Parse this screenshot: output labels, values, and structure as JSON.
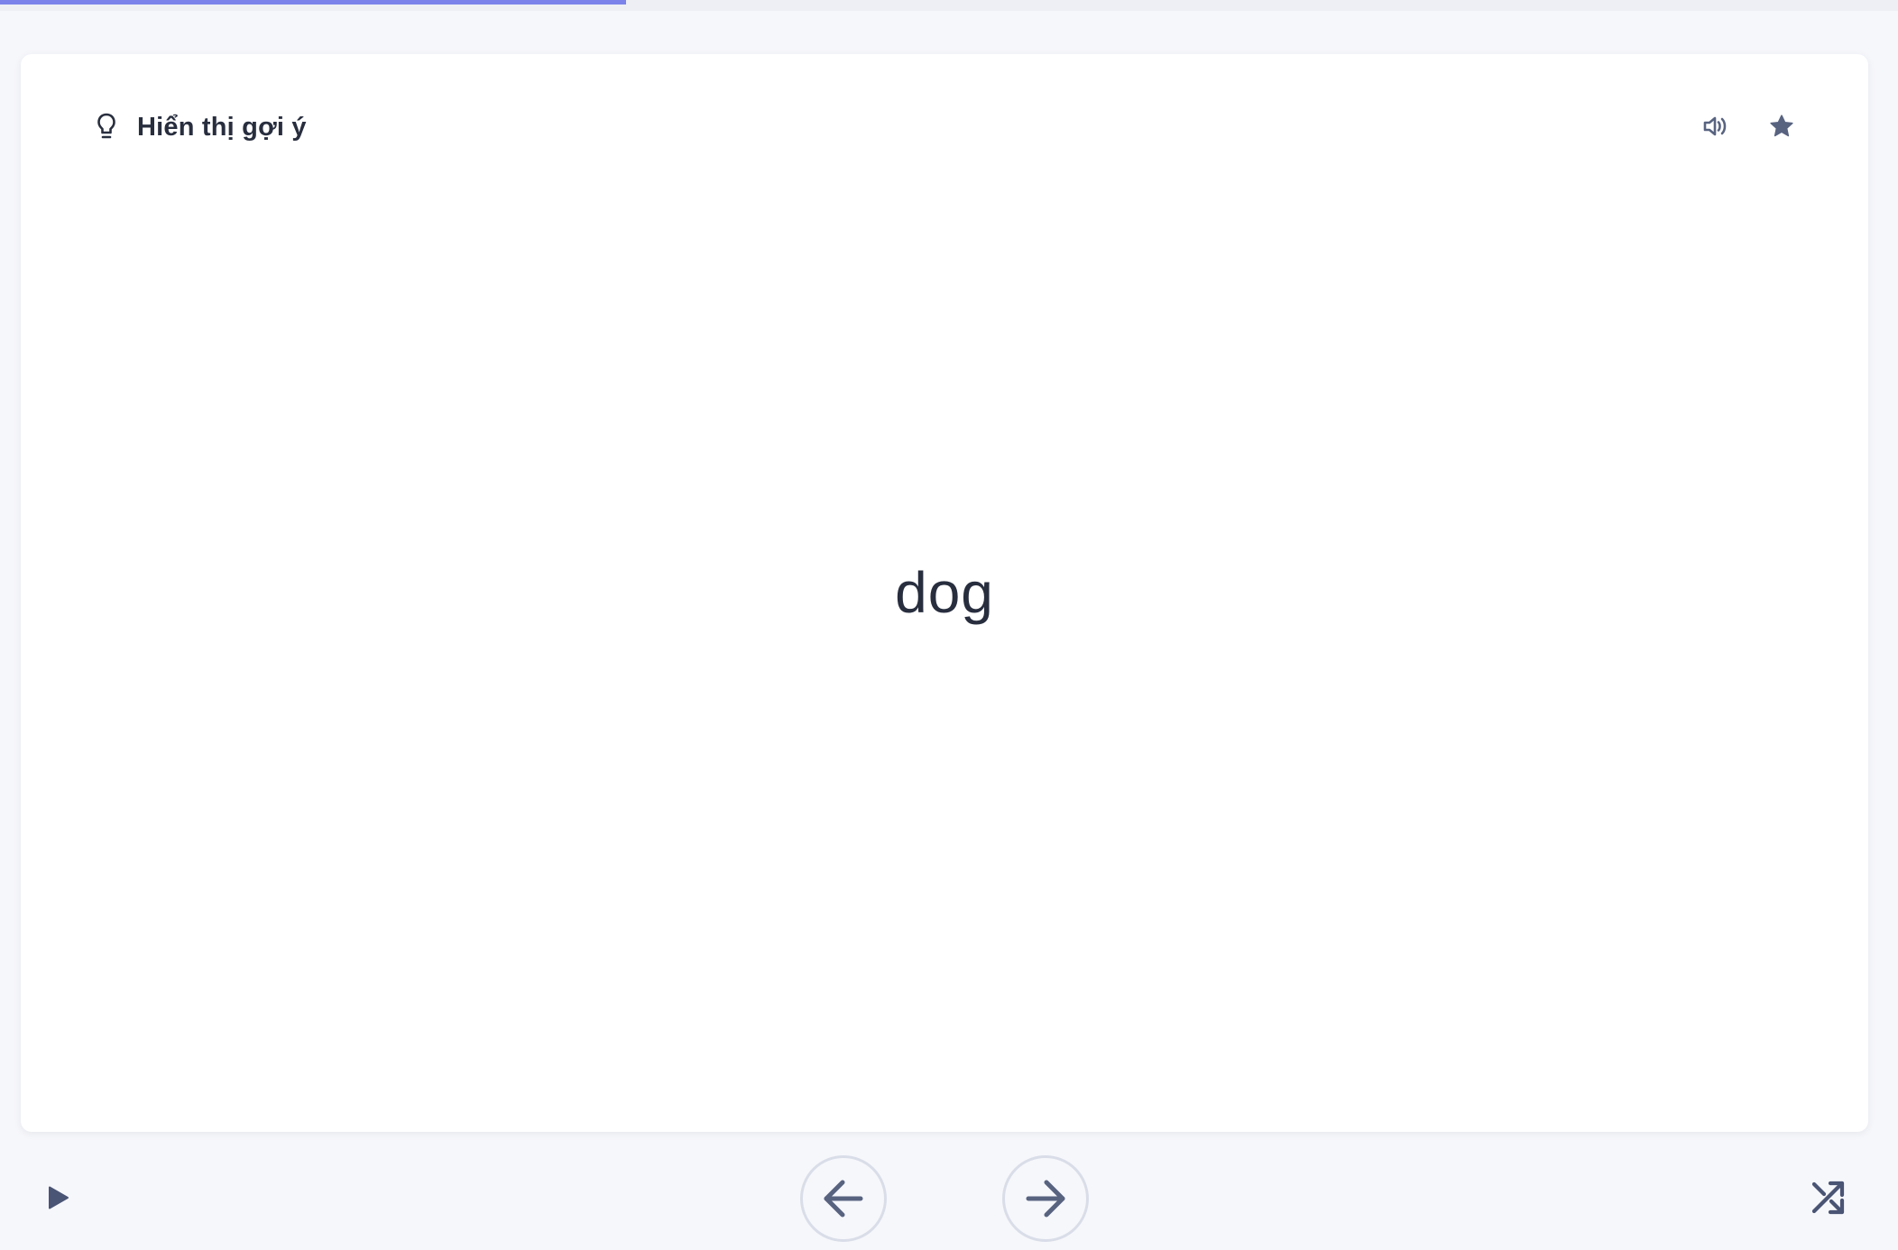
{
  "progress": {
    "fraction": 0.33,
    "color": "#7b83eb"
  },
  "hint": {
    "label": "Hiển thị gợi ý",
    "icon": "lightbulb-icon"
  },
  "card": {
    "term": "dog"
  },
  "actions": {
    "audio_icon": "speaker-icon",
    "star_icon": "star-icon",
    "play_icon": "play-icon",
    "prev_icon": "arrow-left-icon",
    "next_icon": "arrow-right-icon",
    "shuffle_icon": "shuffle-icon"
  }
}
